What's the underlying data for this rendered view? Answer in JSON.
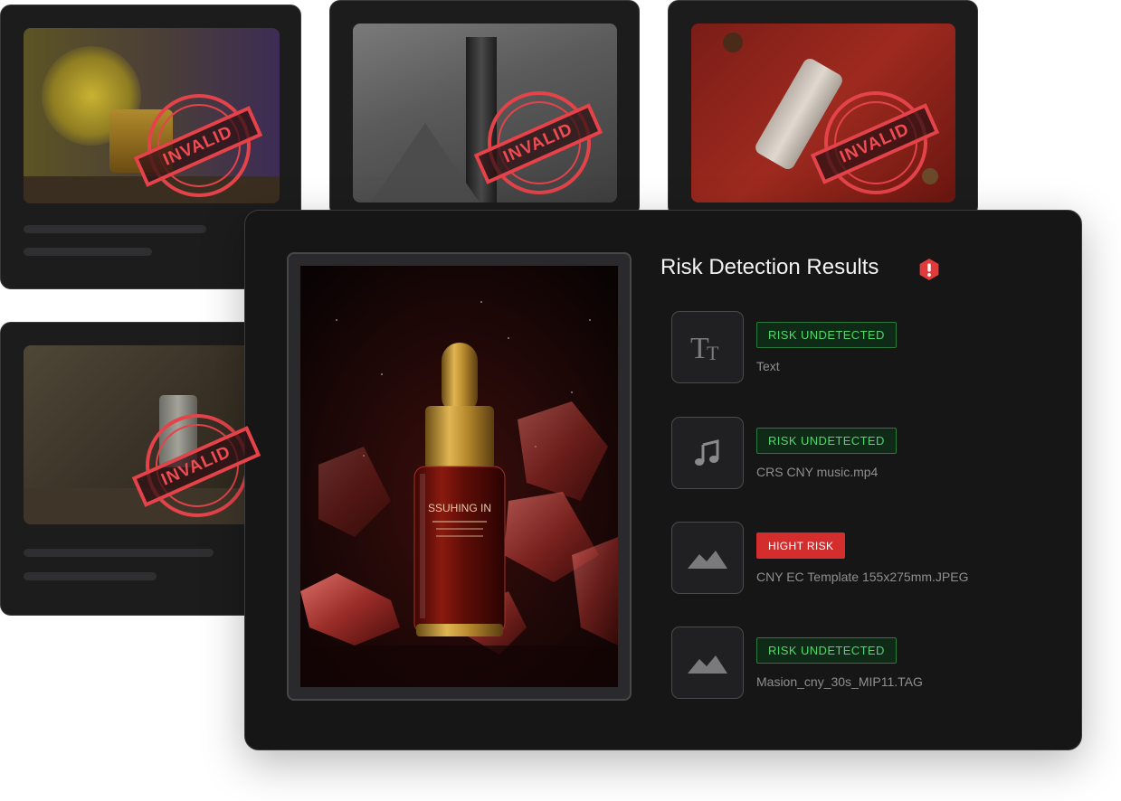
{
  "background_cards": [
    {
      "stamp_label": "INVALID"
    },
    {
      "stamp_label": "INVALID"
    },
    {
      "stamp_label": "INVALID"
    },
    {
      "stamp_label": "INVALID"
    }
  ],
  "panel": {
    "title": "Risk Detection Results",
    "title_icon": "alert-hexagon-icon",
    "bottle_label": "SSUHING IN",
    "results": [
      {
        "icon": "text-type-icon",
        "status": "RISK UNDETECTED",
        "level": "safe",
        "file": "Text"
      },
      {
        "icon": "music-note-icon",
        "status": "RISK UNDETECTED",
        "level": "safe",
        "file": "CRS CNY music.mp4"
      },
      {
        "icon": "image-icon",
        "status": "HIGHT RISK",
        "level": "high",
        "file": "CNY EC Template 155x275mm.JPEG"
      },
      {
        "icon": "image-icon",
        "status": "RISK UNDETECTED",
        "level": "safe",
        "file": "Masion_cny_30s_MIP11.TAG"
      }
    ]
  },
  "colors": {
    "card_bg": "#1c1c1d",
    "panel_bg": "#161617",
    "safe_text": "#4fd86c",
    "safe_border": "#2a7a3e",
    "risk_badge": "#d32d2d",
    "stamp_red": "#e4434a",
    "alert_red": "#e03b3b"
  }
}
